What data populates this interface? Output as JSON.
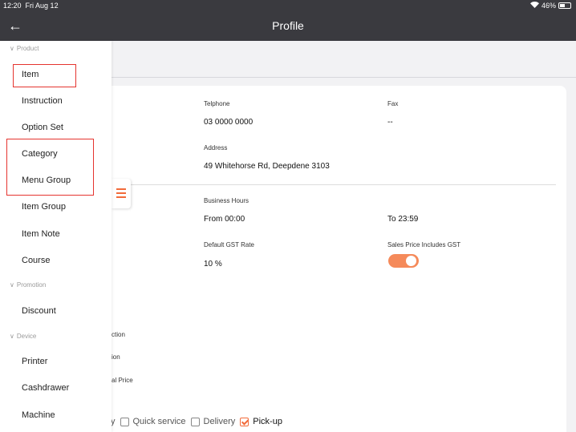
{
  "status_bar": {
    "time": "12:20",
    "date": "Fri Aug 12",
    "battery": "46%"
  },
  "nav": {
    "title": "Profile"
  },
  "sidebar": {
    "sections": [
      {
        "label": "Product",
        "items": [
          "Item",
          "Instruction",
          "Option Set",
          "Category",
          "Menu Group",
          "Item Group",
          "Item Note",
          "Course"
        ]
      },
      {
        "label": "Promotion",
        "items": [
          "Discount"
        ]
      },
      {
        "label": "Device",
        "items": [
          "Printer",
          "Cashdrawer",
          "Machine"
        ]
      }
    ]
  },
  "profile": {
    "telephone": {
      "label": "Telphone",
      "value": "03 0000 0000"
    },
    "fax": {
      "label": "Fax",
      "value": "--"
    },
    "address": {
      "label": "Address",
      "value": "49 Whitehorse Rd, Deepdene 3103"
    },
    "business_hours": {
      "label": "Business Hours",
      "from": "From 00:00",
      "to": "To 23:59"
    },
    "gst": {
      "label": "Default GST Rate",
      "value": "10 %"
    },
    "sales_price_gst": {
      "label": "Sales Price Includes GST",
      "on": true
    },
    "partial_labels": [
      "ction",
      "ion",
      "al Price"
    ],
    "order_types": {
      "leading": "y",
      "options": [
        {
          "label": "Quick service",
          "checked": false
        },
        {
          "label": "Delivery",
          "checked": false
        },
        {
          "label": "Pick-up",
          "checked": true
        }
      ]
    }
  },
  "colors": {
    "accent": "#f26b3a",
    "header": "#3a3a3f",
    "highlight": "#e5342f"
  }
}
